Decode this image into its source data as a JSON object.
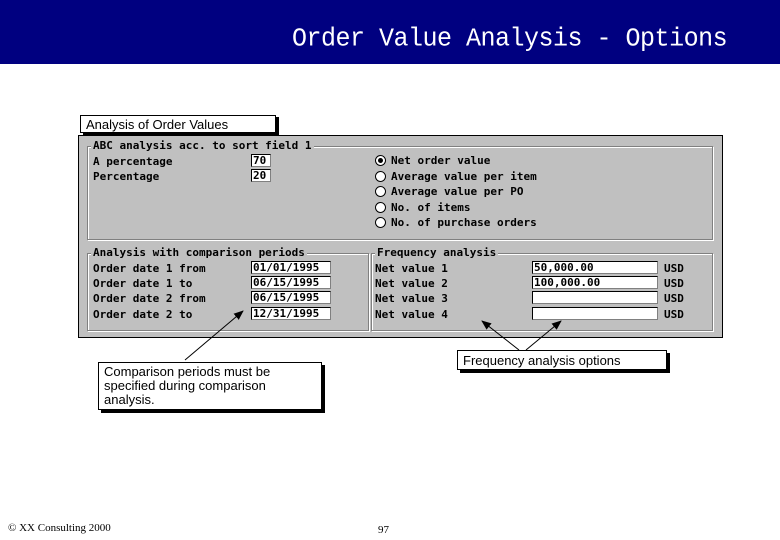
{
  "header": {
    "title": "Order Value Analysis - Options"
  },
  "panel": {
    "tab_label": "Analysis of Order Values",
    "abc_group": {
      "title": "ABC analysis acc. to sort field 1",
      "fields": [
        {
          "label": "A percentage",
          "value": "70"
        },
        {
          "label": "Percentage",
          "value": "20"
        }
      ],
      "options": [
        {
          "label": "Net order value",
          "selected": true
        },
        {
          "label": "Average value per item",
          "selected": false
        },
        {
          "label": "Average value per PO",
          "selected": false
        },
        {
          "label": "No. of items",
          "selected": false
        },
        {
          "label": "No. of purchase orders",
          "selected": false
        }
      ]
    },
    "comparison_group": {
      "title": "Analysis with comparison periods",
      "fields": [
        {
          "label": "Order date 1 from",
          "value": "01/01/1995"
        },
        {
          "label": "Order date 1 to",
          "value": "06/15/1995"
        },
        {
          "label": "Order date 2 from",
          "value": "06/15/1995"
        },
        {
          "label": "Order date 2 to",
          "value": "12/31/1995"
        }
      ]
    },
    "frequency_group": {
      "title": "Frequency analysis",
      "fields": [
        {
          "label": "Net value 1",
          "value": "50,000.00",
          "currency": "USD"
        },
        {
          "label": "Net value 2",
          "value": "100,000.00",
          "currency": "USD"
        },
        {
          "label": "Net value 3",
          "value": "",
          "currency": "USD"
        },
        {
          "label": "Net value 4",
          "value": "",
          "currency": "USD"
        }
      ]
    }
  },
  "callouts": {
    "comparison": "Comparison periods must be specified during comparison analysis.",
    "frequency": "Frequency analysis options"
  },
  "footer": {
    "copyright": "© XX Consulting 2000",
    "page_number": "97"
  },
  "colors": {
    "header_bg": "#000080",
    "panel_bg": "#c0c0c0"
  }
}
